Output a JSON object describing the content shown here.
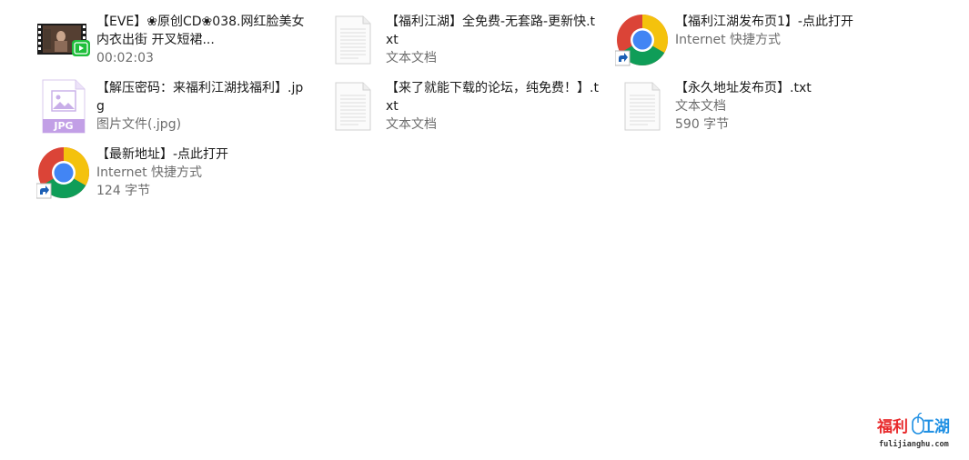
{
  "files": [
    {
      "name": "【EVE】❀原创CD❀038.网红脸美女内衣出街 开叉短裙...",
      "meta1": "00:02:03",
      "meta2": "",
      "icon": "video-thumbnail-icon"
    },
    {
      "name": "【福利江湖】全免费-无套路-更新快.txt",
      "meta1": "文本文档",
      "meta2": "",
      "icon": "text-document-icon"
    },
    {
      "name": "【福利江湖发布页1】-点此打开",
      "meta1": "Internet 快捷方式",
      "meta2": "",
      "icon": "chrome-shortcut-icon"
    },
    {
      "name": "【解压密码：来福利江湖找福利】.jpg",
      "meta1": "图片文件(.jpg)",
      "meta2": "",
      "icon": "jpg-image-icon"
    },
    {
      "name": "【来了就能下载的论坛，纯免费！】.txt",
      "meta1": "文本文档",
      "meta2": "",
      "icon": "text-document-icon"
    },
    {
      "name": "【永久地址发布页】.txt",
      "meta1": "文本文档",
      "meta2": "590 字节",
      "icon": "text-document-icon"
    },
    {
      "name": "【最新地址】-点此打开",
      "meta1": "Internet 快捷方式",
      "meta2": "124 字节",
      "icon": "chrome-shortcut-icon"
    }
  ],
  "icon_labels": {
    "jpg_badge": "JPG"
  },
  "watermark": {
    "title_red": "福利",
    "title_blue": "江湖",
    "url": "fulijianghu.com"
  },
  "colors": {
    "text": "#1a1a1a",
    "meta": "#6d6d6d",
    "chrome_red": "#db4437",
    "chrome_yellow": "#f4c20d",
    "chrome_green": "#0f9d58",
    "chrome_blue": "#4285f4",
    "jpg_purple": "#c29fe6",
    "video_green": "#1fbf3b",
    "watermark_red": "#e8282a",
    "watermark_blue": "#1e8fe3"
  }
}
